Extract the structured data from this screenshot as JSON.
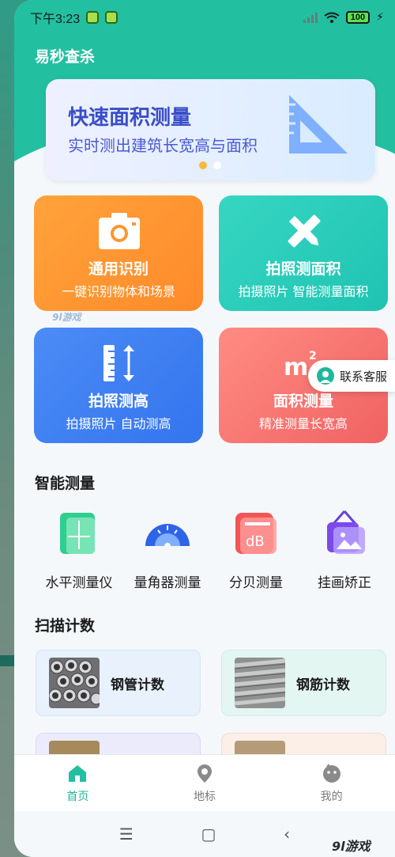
{
  "status_bar": {
    "time": "下午3:23",
    "battery": "100"
  },
  "app": {
    "title": "易秒查杀"
  },
  "banner": {
    "title": "快速面积测量",
    "subtitle": "实时测出建筑长宽高与面积",
    "page_indicator": {
      "active": 1,
      "total": 2
    }
  },
  "feature_cards": [
    {
      "title": "通用识别",
      "subtitle": "一键识别物体和场景",
      "icon": "camera-icon",
      "color": "#ff962f"
    },
    {
      "title": "拍照测面积",
      "subtitle": "拍摄照片 智能测量面积",
      "icon": "ruler-pencil-icon",
      "color": "#2bcdb9"
    },
    {
      "title": "拍照测高",
      "subtitle": "拍摄照片 自动测高",
      "icon": "height-ruler-icon",
      "color": "#3f80f2"
    },
    {
      "title": "面积测量",
      "subtitle": "精准测量长宽高",
      "icon": "square-meter-icon",
      "color": "#f47670"
    }
  ],
  "customer_service": {
    "label": "联系客服"
  },
  "watermarks": {
    "small": "9l游戏",
    "bottom": "9l游戏"
  },
  "smart_measure": {
    "title": "智能测量",
    "tools": [
      {
        "label": "水平测量仪",
        "icon": "level-icon"
      },
      {
        "label": "量角器测量",
        "icon": "protractor-icon"
      },
      {
        "label": "分贝测量",
        "icon": "decibel-icon"
      },
      {
        "label": "挂画矫正",
        "icon": "picture-frame-icon"
      }
    ]
  },
  "scan_count": {
    "title": "扫描计数",
    "items": [
      {
        "label": "钢管计数",
        "icon": "steel-pipe-thumb"
      },
      {
        "label": "钢筋计数",
        "icon": "rebar-thumb"
      }
    ]
  },
  "bottom_nav": {
    "items": [
      {
        "label": "首页",
        "icon": "home-icon",
        "active": true
      },
      {
        "label": "地标",
        "icon": "location-pin-icon",
        "active": false
      },
      {
        "label": "我的",
        "icon": "profile-face-icon",
        "active": false
      }
    ]
  },
  "colors": {
    "accent": "#23bfa1",
    "banner_text": "#3a4ec8"
  }
}
